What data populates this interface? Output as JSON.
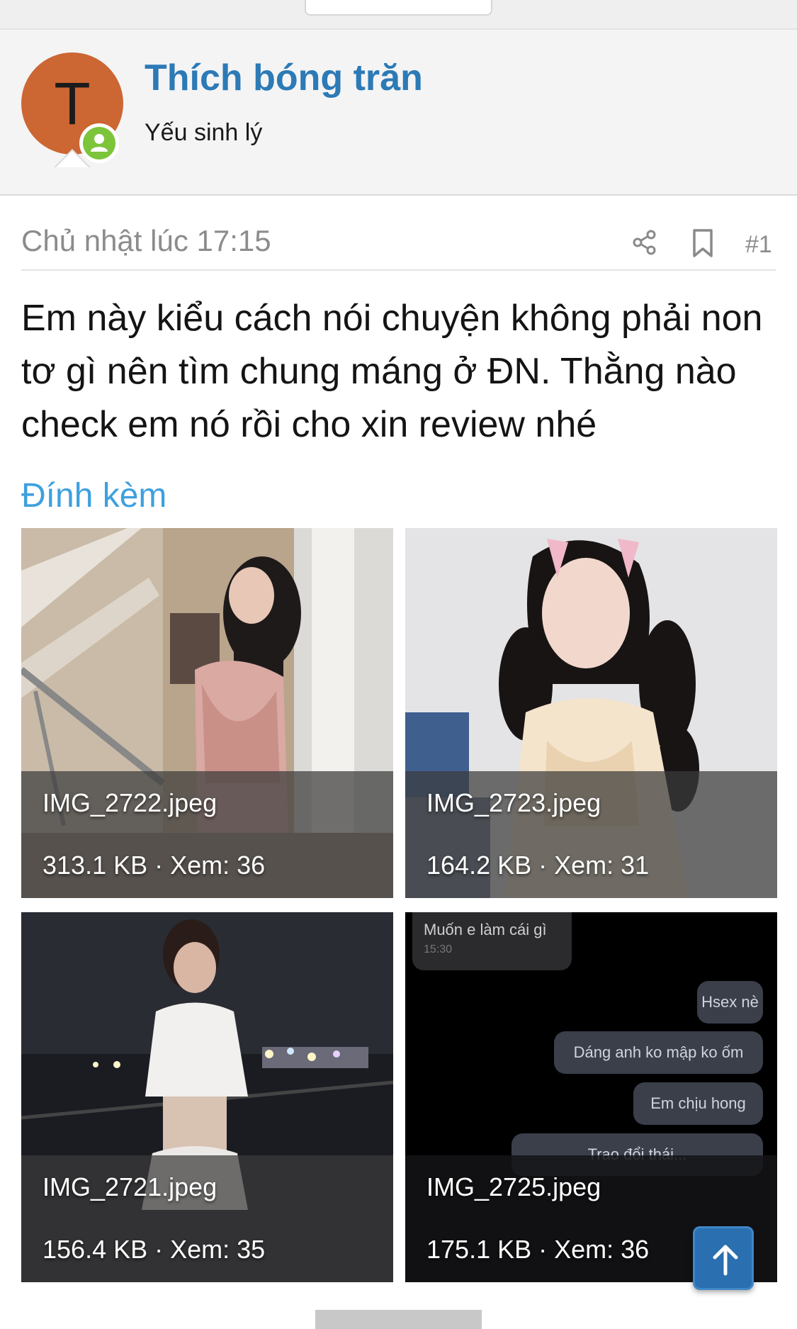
{
  "user": {
    "avatar_letter": "T",
    "name": "Thích bóng trăn",
    "title": "Yếu sinh lý",
    "avatar_color": "#cc6633",
    "online_badge_color": "#7cc43a"
  },
  "post": {
    "date": "Chủ nhật lúc 17:15",
    "number": "#1",
    "body": "Em này kiểu cách nói chuyện không phải non tơ gì nên tìm chung máng ở ĐN. Thằng nào check em nó rồi cho xin review nhé",
    "share_icon": "share-icon",
    "bookmark_icon": "bookmark-icon"
  },
  "attachments": {
    "title": "Đính kèm",
    "items": [
      {
        "filename": "IMG_2722.jpeg",
        "meta": "313.1 KB · Xem: 36"
      },
      {
        "filename": "IMG_2723.jpeg",
        "meta": "164.2 KB · Xem: 31"
      },
      {
        "filename": "IMG_2721.jpeg",
        "meta": "156.4 KB · Xem: 35"
      },
      {
        "filename": "IMG_2725.jpeg",
        "meta": "175.1 KB · Xem: 36"
      }
    ],
    "chat_thumb": {
      "incoming": "Muốn e làm cái gì",
      "incoming_time": "15:30",
      "outgoing": [
        "Hsex nè",
        "Dáng anh ko mập ko ốm",
        "Em chịu hong",
        "Trao đổi thái..."
      ]
    }
  },
  "scroll_top_icon": "arrow-up-icon",
  "colors": {
    "link_blue": "#2c7ab6",
    "attach_blue": "#3ea0df",
    "scroll_button": "#2a6fb0"
  }
}
